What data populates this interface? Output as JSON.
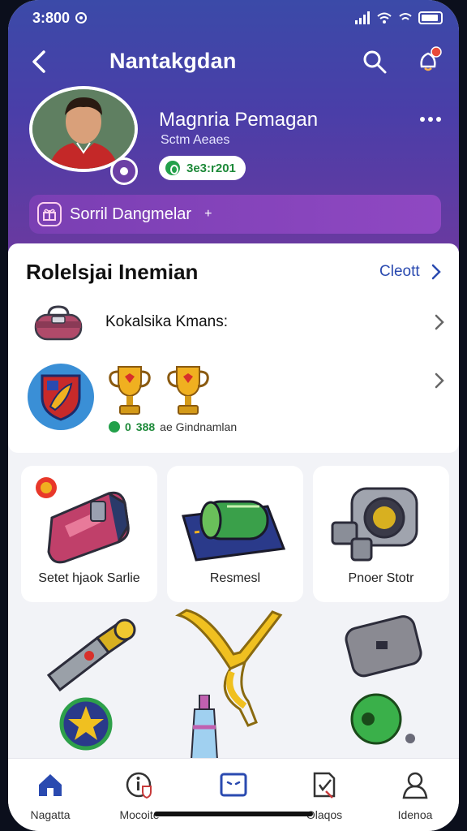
{
  "status": {
    "time": "3:800"
  },
  "nav": {
    "title": "Nantakgdan"
  },
  "profile": {
    "name": "Magnria Pemagan",
    "subtitle": "Sctm Aeaes",
    "pill": "3e3:r201"
  },
  "banner": {
    "text": "Sorril Dangmelar",
    "plus": "+"
  },
  "section": {
    "title": "Rolelsjai Inemian",
    "link": "Cleott"
  },
  "rows": {
    "row1_label": "Kokalsika Kmans:",
    "row2_stat_value": "388",
    "row2_stat_text": "ae Gindnamlan",
    "row2_stat_prefix": "0"
  },
  "tiles": [
    {
      "label": "Setet hjaok Sarlie"
    },
    {
      "label": "Resmesl"
    },
    {
      "label": "Pnoer Stotr"
    }
  ],
  "tabs": [
    {
      "label": "Nagatta",
      "icon": "home-icon"
    },
    {
      "label": "Mocoite",
      "icon": "info-shield-icon"
    },
    {
      "label": "",
      "icon": "face-box-icon"
    },
    {
      "label": "Olaqos",
      "icon": "clipboard-icon"
    },
    {
      "label": "Idenoa",
      "icon": "user-icon"
    }
  ],
  "colors": {
    "header_top": "#3b4aa8",
    "header_bottom": "#6a3aa0",
    "accent": "#2a4ab0",
    "active_tab": "#2a4ab0",
    "banner": "#8f48c2"
  }
}
